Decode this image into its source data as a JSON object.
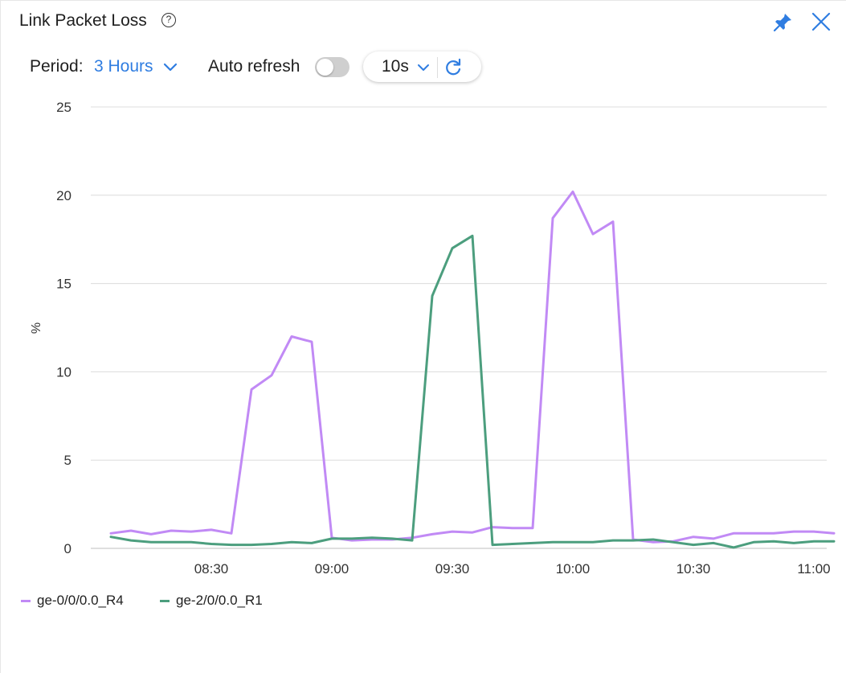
{
  "panel": {
    "title": "Link Packet Loss",
    "help_icon": "question-circle-icon",
    "pin_icon": "pin-icon",
    "close_icon": "close-icon"
  },
  "controls": {
    "period_label": "Period:",
    "period_value": "3 Hours",
    "auto_refresh_label": "Auto refresh",
    "auto_refresh_on": false,
    "interval_value": "10s",
    "refresh_icon": "refresh-icon"
  },
  "colors": {
    "accent": "#2f7de1",
    "series_r4": "#c18af5",
    "series_r1": "#4c9e7e",
    "grid": "#dcdcdc"
  },
  "chart_data": {
    "type": "line",
    "title": "",
    "xlabel": "",
    "ylabel": "%",
    "ylim": [
      0,
      25
    ],
    "yticks": [
      "0",
      "5",
      "10",
      "15",
      "20",
      "25"
    ],
    "xticks": [
      "08:30",
      "09:00",
      "09:30",
      "10:00",
      "10:30",
      "11:00"
    ],
    "grid": true,
    "legend_position": "bottom-left",
    "x_time": [
      "08:05",
      "08:10",
      "08:15",
      "08:20",
      "08:25",
      "08:30",
      "08:35",
      "08:40",
      "08:45",
      "08:50",
      "08:55",
      "09:00",
      "09:05",
      "09:10",
      "09:15",
      "09:20",
      "09:25",
      "09:30",
      "09:35",
      "09:40",
      "09:45",
      "09:50",
      "09:55",
      "10:00",
      "10:05",
      "10:10",
      "10:15",
      "10:20",
      "10:25",
      "10:30",
      "10:35",
      "10:40",
      "10:45",
      "10:50",
      "10:55",
      "11:00",
      "11:05"
    ],
    "series": [
      {
        "name": "ge-0/0/0.0_R4",
        "color": "#c18af5",
        "values": [
          0.85,
          1.0,
          0.8,
          1.0,
          0.95,
          1.05,
          0.85,
          9.0,
          9.8,
          12.0,
          11.7,
          0.6,
          0.45,
          0.5,
          0.5,
          0.6,
          0.8,
          0.95,
          0.9,
          1.2,
          1.15,
          1.15,
          18.7,
          20.2,
          17.8,
          18.5,
          0.5,
          0.35,
          0.4,
          0.65,
          0.55,
          0.85,
          0.85,
          0.85,
          0.95,
          0.95,
          0.85
        ]
      },
      {
        "name": "ge-2/0/0.0_R1",
        "color": "#4c9e7e",
        "values": [
          0.65,
          0.45,
          0.35,
          0.35,
          0.35,
          0.25,
          0.2,
          0.2,
          0.25,
          0.35,
          0.3,
          0.55,
          0.55,
          0.6,
          0.55,
          0.45,
          14.3,
          17.0,
          17.7,
          0.2,
          0.25,
          0.3,
          0.35,
          0.35,
          0.35,
          0.45,
          0.45,
          0.5,
          0.35,
          0.2,
          0.3,
          0.05,
          0.35,
          0.4,
          0.3,
          0.4,
          0.4
        ]
      }
    ]
  }
}
